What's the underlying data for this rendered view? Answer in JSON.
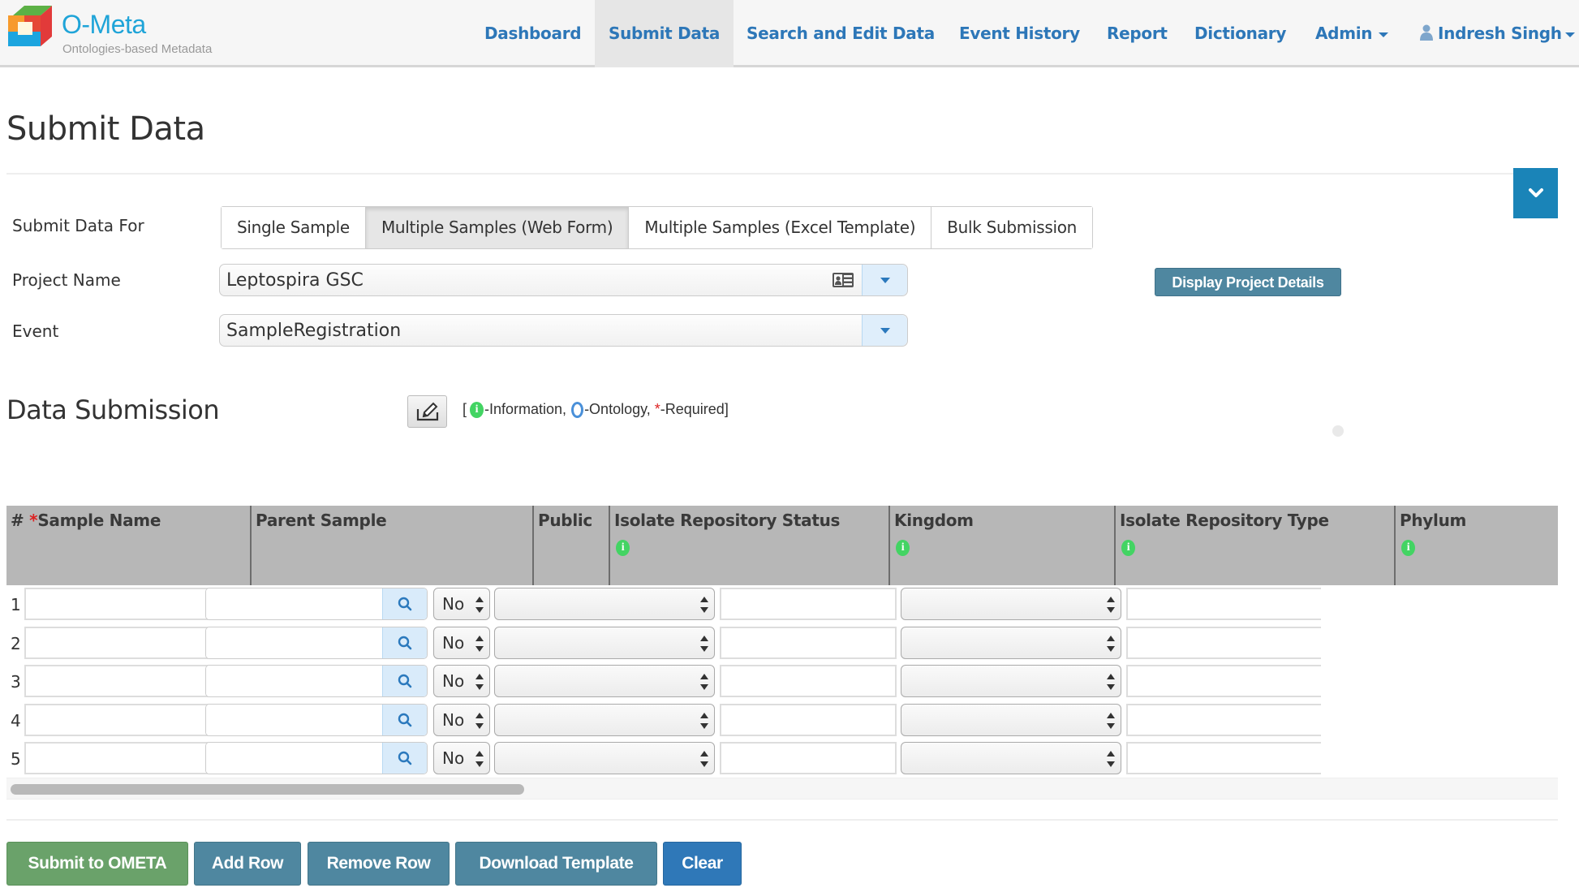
{
  "brand": {
    "name": "O-Meta",
    "tagline": "Ontologies-based Metadata",
    "colors": {
      "red": "#e23a3a",
      "green": "#5cb146",
      "orange": "#f79a2c",
      "blue": "#1ca5df"
    }
  },
  "nav": {
    "items": [
      {
        "label": "Dashboard",
        "active": false
      },
      {
        "label": "Submit Data",
        "active": true
      },
      {
        "label": "Search and Edit Data",
        "active": false
      },
      {
        "label": "Event History",
        "active": false
      },
      {
        "label": "Report",
        "active": false
      },
      {
        "label": "Dictionary",
        "active": false
      },
      {
        "label": "Admin",
        "active": false,
        "dropdown": true
      }
    ],
    "user": {
      "name": "Indresh Singh",
      "icon": "user-icon",
      "dropdown": true
    }
  },
  "page": {
    "title": "Submit Data",
    "collapse_icon": "chevron-down-icon"
  },
  "form": {
    "submit_for_label": "Submit Data For",
    "modes": [
      {
        "label": "Single Sample",
        "active": false
      },
      {
        "label": "Multiple Samples (Web Form)",
        "active": true
      },
      {
        "label": "Multiple Samples (Excel Template)",
        "active": false
      },
      {
        "label": "Bulk Submission",
        "active": false
      }
    ],
    "project_label": "Project Name",
    "project_value": "Leptospira GSC",
    "event_label": "Event",
    "event_value": "SampleRegistration",
    "display_project_details": "Display Project Details"
  },
  "data_submission": {
    "title": "Data Submission",
    "legend": {
      "open": "[",
      "info_glyph": "i",
      "info_text": "-Information,",
      "ontology_text": "-Ontology,",
      "required_glyph": "*",
      "required_text": "-Required]"
    },
    "columns": [
      {
        "label": "#",
        "info": false
      },
      {
        "label": "Sample Name",
        "required": true,
        "info": false
      },
      {
        "label": "Parent Sample",
        "info": false
      },
      {
        "label": "Public",
        "info": false
      },
      {
        "label": "Isolate Repository Status",
        "info": true
      },
      {
        "label": "Kingdom",
        "info": true
      },
      {
        "label": "Isolate Repository Type",
        "info": true
      },
      {
        "label": "Phylum",
        "info": true
      }
    ],
    "rows": [
      {
        "num": "1",
        "sample_name": "",
        "parent_sample": "",
        "public": "No",
        "isolate_repository_status": "",
        "kingdom": "",
        "isolate_repository_type": "",
        "phylum": ""
      },
      {
        "num": "2",
        "sample_name": "",
        "parent_sample": "",
        "public": "No",
        "isolate_repository_status": "",
        "kingdom": "",
        "isolate_repository_type": "",
        "phylum": ""
      },
      {
        "num": "3",
        "sample_name": "",
        "parent_sample": "",
        "public": "No",
        "isolate_repository_status": "",
        "kingdom": "",
        "isolate_repository_type": "",
        "phylum": ""
      },
      {
        "num": "4",
        "sample_name": "",
        "parent_sample": "",
        "public": "No",
        "isolate_repository_status": "",
        "kingdom": "",
        "isolate_repository_type": "",
        "phylum": ""
      },
      {
        "num": "5",
        "sample_name": "",
        "parent_sample": "",
        "public": "No",
        "isolate_repository_status": "",
        "kingdom": "",
        "isolate_repository_type": "",
        "phylum": ""
      }
    ]
  },
  "actions": {
    "submit": {
      "label": "Submit to OMETA",
      "color": "#6aa26a"
    },
    "add_row": {
      "label": "Add Row",
      "color": "#4f87a0"
    },
    "remove_row": {
      "label": "Remove Row",
      "color": "#4f87a0"
    },
    "download_template": {
      "label": "Download Template",
      "color": "#4f87a0"
    },
    "clear": {
      "label": "Clear",
      "color": "#2f78b8"
    }
  }
}
